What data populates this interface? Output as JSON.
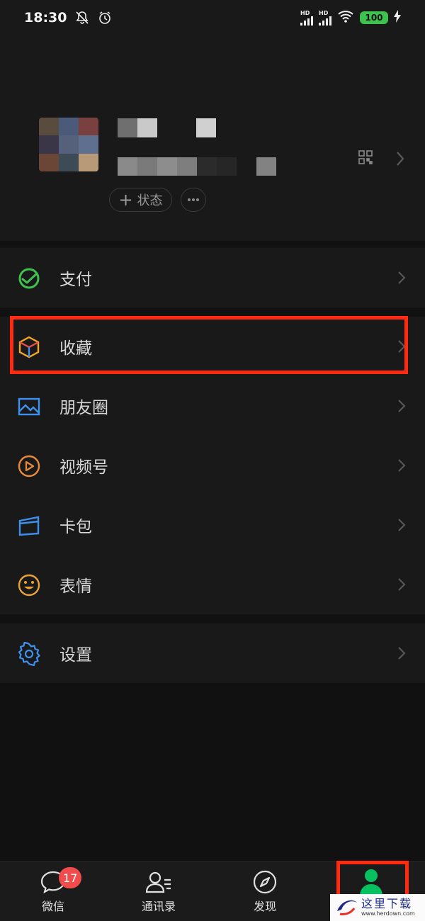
{
  "status_bar": {
    "time": "18:30",
    "signal_1": "HD",
    "signal_2": "HD",
    "battery": "100"
  },
  "profile": {
    "status_button": "状态"
  },
  "menu": {
    "pay": "支付",
    "favorites": "收藏",
    "moments": "朋友圈",
    "channels": "视频号",
    "cards": "卡包",
    "stickers": "表情",
    "settings": "设置"
  },
  "tabbar": {
    "chats": "微信",
    "chats_badge": "17",
    "contacts": "通讯录",
    "discover": "发现",
    "me_active_color": "#07c160"
  },
  "colors": {
    "highlight": "#ff2a10",
    "pay_icon": "#3ec24f",
    "settings_icon": "#3e90ee"
  },
  "watermark": {
    "text": "这里下载",
    "url": "www.herdown.com"
  }
}
